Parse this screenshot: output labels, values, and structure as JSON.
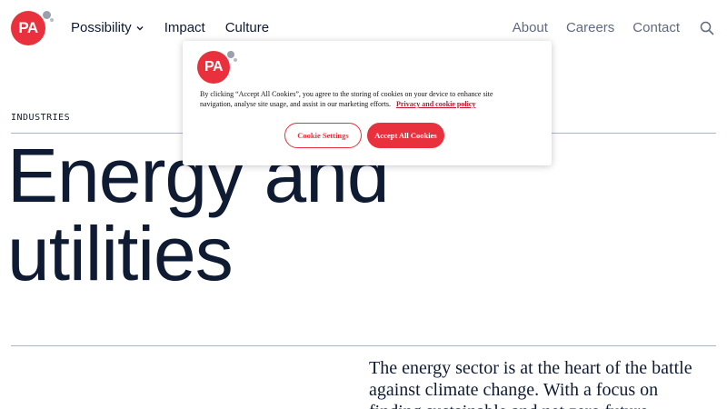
{
  "brand": {
    "logo_text": "PA",
    "accent_color": "#e8313d"
  },
  "nav": {
    "left": [
      {
        "label": "Possibility",
        "has_dropdown": true
      },
      {
        "label": "Impact",
        "has_dropdown": false
      },
      {
        "label": "Culture",
        "has_dropdown": false
      }
    ],
    "right": [
      {
        "label": "About"
      },
      {
        "label": "Careers"
      },
      {
        "label": "Contact"
      }
    ],
    "search_icon": "search-icon"
  },
  "page": {
    "eyebrow": "INDUSTRIES",
    "title": "Energy and utilities",
    "intro": "The energy sector is at the heart of the battle against climate change. With a focus on finding sustainable and net zero future..."
  },
  "cookie_banner": {
    "text": "By clicking “Accept All Cookies”, you agree to the storing of cookies on your device to enhance site navigation, analyse site usage, and assist in our marketing efforts.",
    "link_label": "Privacy and cookie policy",
    "settings_label": "Cookie Settings",
    "accept_label": "Accept All Cookies"
  }
}
